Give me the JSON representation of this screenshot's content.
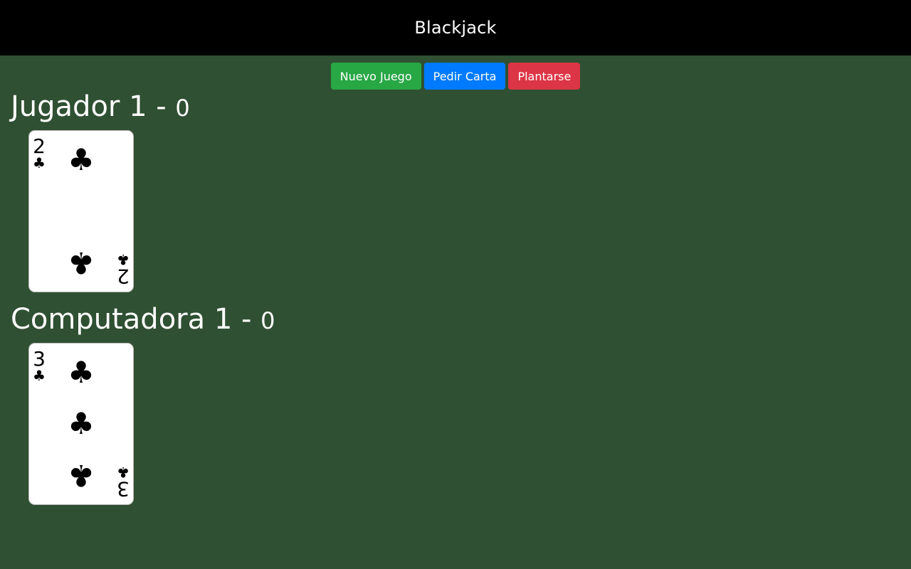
{
  "header": {
    "title": "Blackjack"
  },
  "controls": {
    "new_game": "Nuevo Juego",
    "hit": "Pedir Carta",
    "stand": "Plantarse"
  },
  "players": [
    {
      "name": "Jugador 1 - ",
      "score": "0",
      "cards": [
        {
          "rank": "2",
          "suit": "♣",
          "suit_name": "clubs"
        }
      ]
    },
    {
      "name": "Computadora 1 - ",
      "score": "0",
      "cards": [
        {
          "rank": "3",
          "suit": "♣",
          "suit_name": "clubs"
        }
      ]
    }
  ],
  "colors": {
    "background": "#2f5032",
    "header": "#000000",
    "success": "#28a745",
    "primary": "#007bff",
    "danger": "#dc3545"
  }
}
